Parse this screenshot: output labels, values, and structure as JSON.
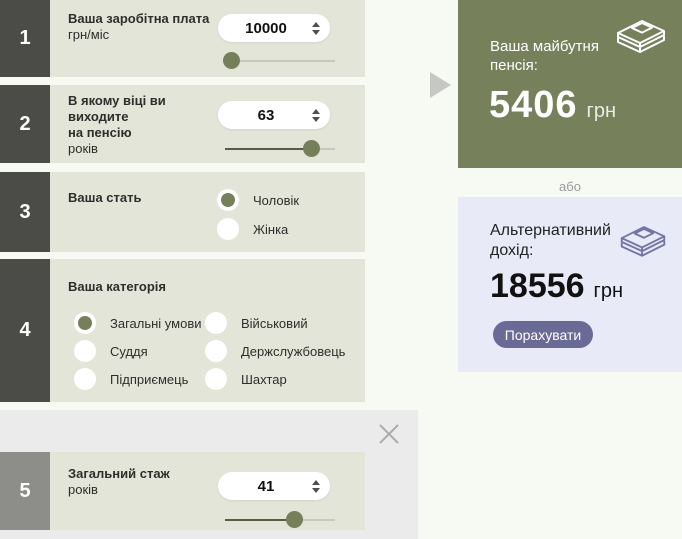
{
  "calculator": {
    "sections": [
      {
        "number": "1",
        "title": "Ваша заробітна плата",
        "unit": "грн/міс",
        "value": "10000",
        "slider_percent": 5
      },
      {
        "number": "2",
        "title_line1": "В якому віці ви виходите",
        "title_line2": "на пенсію",
        "unit": "років",
        "value": "63",
        "slider_percent": 78
      },
      {
        "number": "3",
        "title": "Ваша стать",
        "options": [
          {
            "label": "Чоловік",
            "selected": true
          },
          {
            "label": "Жінка",
            "selected": false
          }
        ]
      },
      {
        "number": "4",
        "title": "Ваша категорія",
        "options": [
          {
            "label": "Загальні умови",
            "selected": true
          },
          {
            "label": "Військовий",
            "selected": false
          },
          {
            "label": "Суддя",
            "selected": false
          },
          {
            "label": "Держслужбовець",
            "selected": false
          },
          {
            "label": "Підприємець",
            "selected": false
          },
          {
            "label": "Шахтар",
            "selected": false
          }
        ]
      },
      {
        "number": "5",
        "title": "Загальний стаж",
        "unit": "років",
        "value": "41",
        "slider_percent": 63
      }
    ]
  },
  "result": {
    "title_line1": "Ваша майбутня",
    "title_line2": "пенсія:",
    "value": "5406",
    "currency": "грн"
  },
  "divider": {
    "or_label": "або"
  },
  "alternative": {
    "title_line1": "Альтернативний",
    "title_line2": "дохід:",
    "value": "18556",
    "currency": "грн",
    "button_label": "Порахувати"
  },
  "icons": {
    "money": "money-stack-icon",
    "close": "close-icon",
    "pointer": "arrow-right-icon"
  },
  "colors": {
    "accent_olive": "#76805b",
    "row_bg": "#e3e5d9",
    "number_block": "#4b4b47",
    "number_block_inactive": "#8d8d8a",
    "alt_panel_bg": "#e9eaf7",
    "button_purple": "#6a6a97",
    "overlay_bg": "#ebebeb",
    "page_bg": "#f6faf3"
  }
}
